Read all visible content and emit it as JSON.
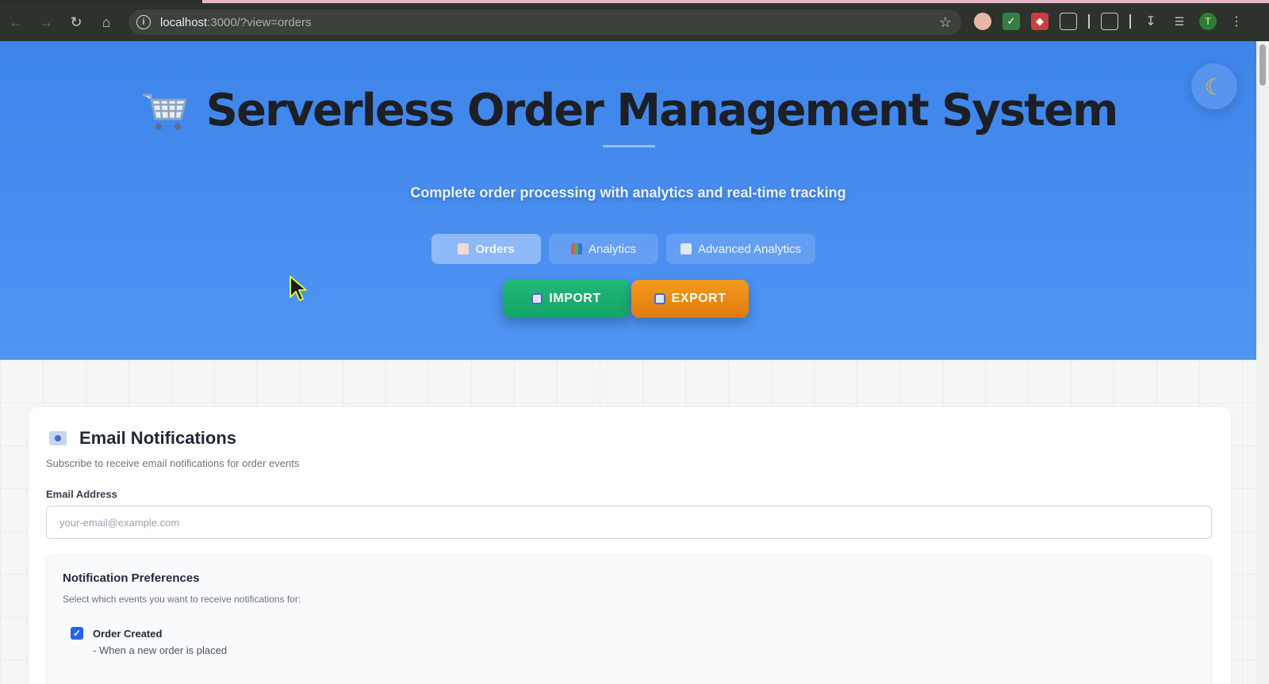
{
  "browser": {
    "url_host": "localhost",
    "url_rest": ":3000/?view=orders",
    "profile_initial": "T"
  },
  "header": {
    "title": "Serverless Order Management System",
    "subtitle": "Complete order processing with analytics and real-time tracking",
    "dark_mode_icon": "moon-icon"
  },
  "tabs": [
    {
      "label": "Orders",
      "icon": "clipboard-icon",
      "active": true
    },
    {
      "label": "Analytics",
      "icon": "bar-chart-icon",
      "active": false
    },
    {
      "label": "Advanced Analytics",
      "icon": "line-chart-icon",
      "active": false
    }
  ],
  "actions": {
    "import_label": "IMPORT",
    "export_label": "EXPORT"
  },
  "notifications": {
    "title": "Email Notifications",
    "description": "Subscribe to receive email notifications for order events",
    "email_label": "Email Address",
    "email_placeholder": "your-email@example.com",
    "email_value": "",
    "prefs_title": "Notification Preferences",
    "prefs_description": "Select which events you want to receive notifications for:",
    "items": [
      {
        "label": "Order Created",
        "description": "- When a new order is placed",
        "checked": true
      }
    ]
  },
  "colors": {
    "hero": "#4a8ff0",
    "import": "#1fb978",
    "export": "#f39b1f",
    "checkbox": "#2563eb"
  }
}
